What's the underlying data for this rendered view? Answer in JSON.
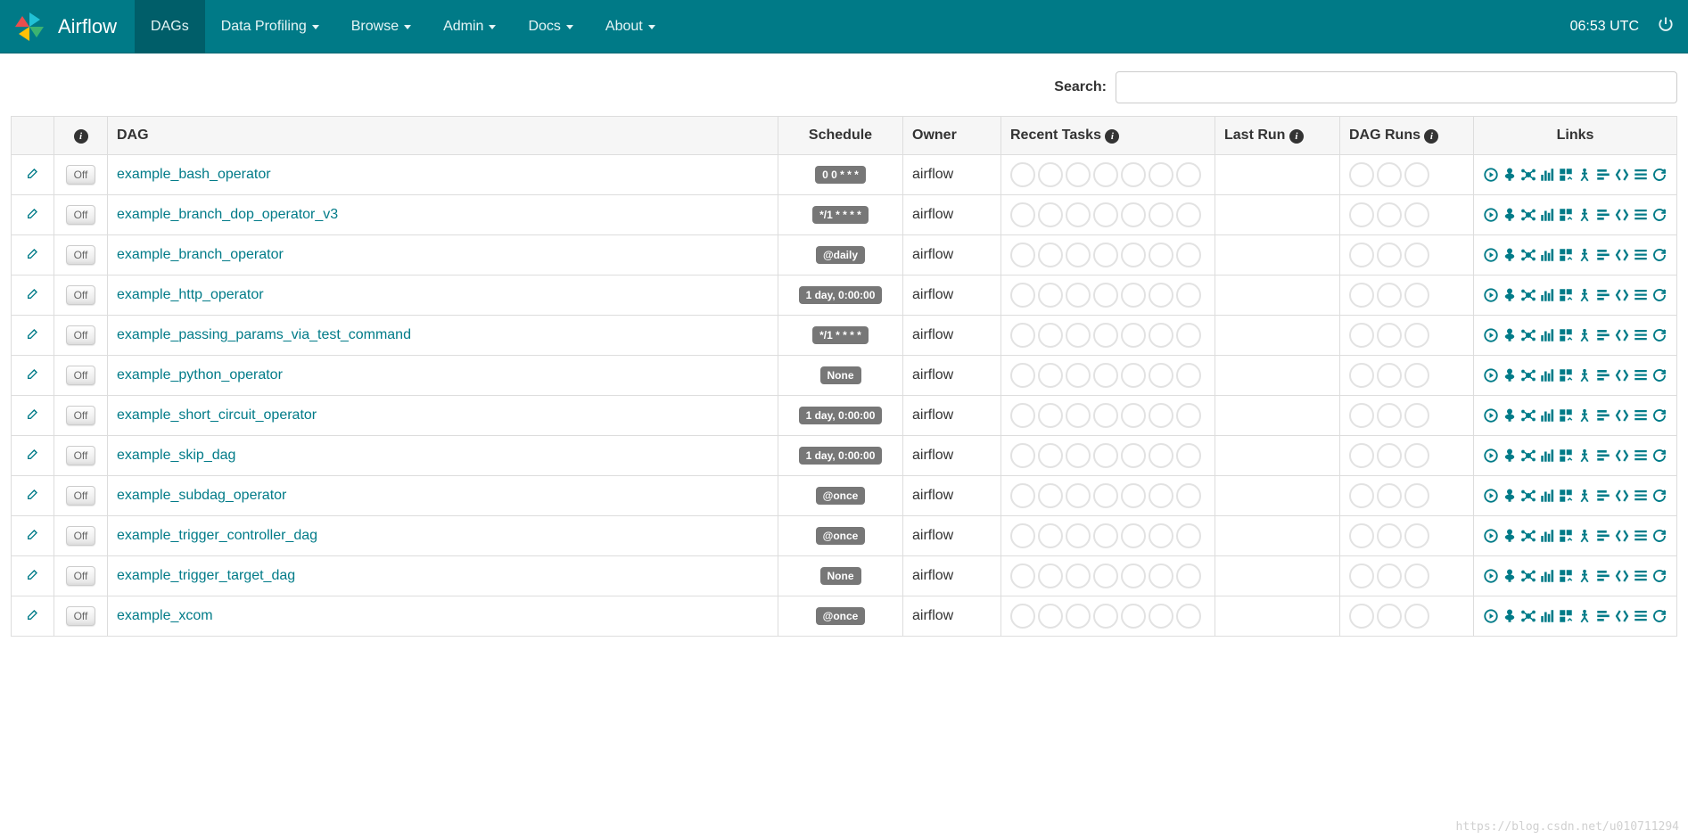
{
  "nav": {
    "brand": "Airflow",
    "items": [
      {
        "label": "DAGs",
        "active": true,
        "dropdown": false
      },
      {
        "label": "Data Profiling",
        "active": false,
        "dropdown": true
      },
      {
        "label": "Browse",
        "active": false,
        "dropdown": true
      },
      {
        "label": "Admin",
        "active": false,
        "dropdown": true
      },
      {
        "label": "Docs",
        "active": false,
        "dropdown": true
      },
      {
        "label": "About",
        "active": false,
        "dropdown": true
      }
    ],
    "clock": "06:53 UTC"
  },
  "search": {
    "label": "Search:",
    "value": ""
  },
  "table": {
    "headers": {
      "dag": "DAG",
      "schedule": "Schedule",
      "owner": "Owner",
      "recent": "Recent Tasks",
      "lastrun": "Last Run",
      "dagruns": "DAG Runs",
      "links": "Links"
    },
    "toggle_label": "Off",
    "rows": [
      {
        "dag": "example_bash_operator",
        "schedule": "0 0 * * *",
        "owner": "airflow"
      },
      {
        "dag": "example_branch_dop_operator_v3",
        "schedule": "*/1 * * * *",
        "owner": "airflow"
      },
      {
        "dag": "example_branch_operator",
        "schedule": "@daily",
        "owner": "airflow"
      },
      {
        "dag": "example_http_operator",
        "schedule": "1 day, 0:00:00",
        "owner": "airflow"
      },
      {
        "dag": "example_passing_params_via_test_command",
        "schedule": "*/1 * * * *",
        "owner": "airflow"
      },
      {
        "dag": "example_python_operator",
        "schedule": "None",
        "owner": "airflow"
      },
      {
        "dag": "example_short_circuit_operator",
        "schedule": "1 day, 0:00:00",
        "owner": "airflow"
      },
      {
        "dag": "example_skip_dag",
        "schedule": "1 day, 0:00:00",
        "owner": "airflow"
      },
      {
        "dag": "example_subdag_operator",
        "schedule": "@once",
        "owner": "airflow"
      },
      {
        "dag": "example_trigger_controller_dag",
        "schedule": "@once",
        "owner": "airflow"
      },
      {
        "dag": "example_trigger_target_dag",
        "schedule": "None",
        "owner": "airflow"
      },
      {
        "dag": "example_xcom",
        "schedule": "@once",
        "owner": "airflow"
      }
    ]
  },
  "watermark": "https://blog.csdn.net/u010711294"
}
